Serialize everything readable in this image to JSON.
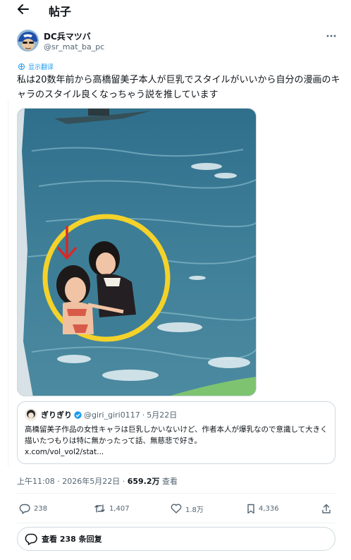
{
  "header": {
    "title": "帖子"
  },
  "author": {
    "display_name": "DC兵マツバ",
    "handle": "@sr_mat_ba_pc"
  },
  "translate_label": "显示翻译",
  "tweet_text": "私は20数年前から高橋留美子本人が巨乳でスタイルがいいから自分の漫画のキャラのスタイル良くなっちゃう説を推しています",
  "quote": {
    "display_name": "ぎりぎり",
    "handle": "@giri_giri0117",
    "separator": "·",
    "date": "5月22日",
    "text": "高橋留美子作品の女性キャラは巨乳しかいないけど、作者本人が爆乳なので意識して大きく描いたつもりは特に無かったって話、無慈悲で好き。",
    "link": "x.com/vol_vol2/stat..."
  },
  "meta": {
    "time": "上午11:08",
    "separator": "·",
    "date": "2026年5月22日",
    "views": "659.2万",
    "views_label": "查看"
  },
  "actions": {
    "replies": "238",
    "reposts": "1,407",
    "likes": "1.8万",
    "bookmarks": "4,336"
  },
  "reply_bar": {
    "label": "查看 238 条回复"
  },
  "colors": {
    "accent": "#1d9bf0",
    "muted": "#536471",
    "border": "#cfd9de"
  }
}
